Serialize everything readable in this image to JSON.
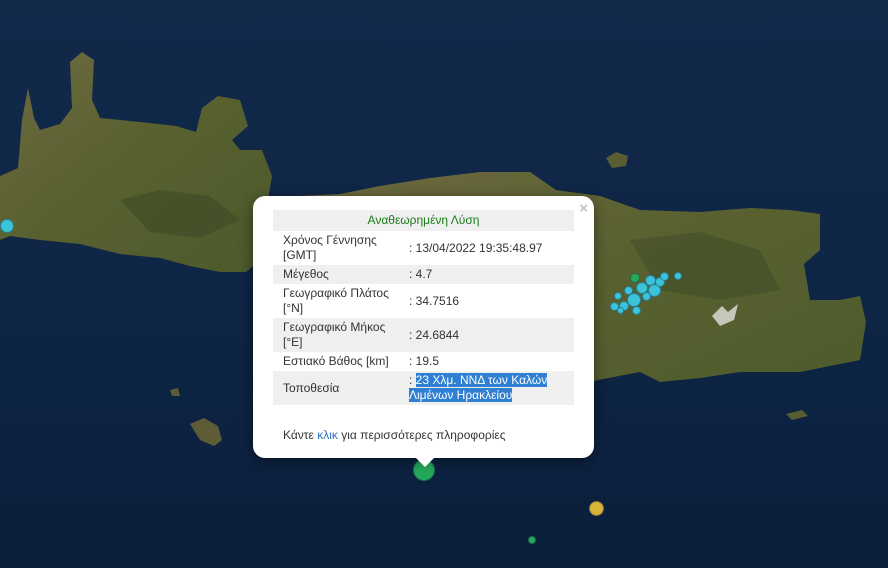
{
  "popup": {
    "close_symbol": "×",
    "heading": "Αναθεωρημένη Λύση",
    "rows": [
      {
        "label": "Χρόνος Γέννησης [GMT]",
        "value": ": 13/04/2022 19:35:48.97"
      },
      {
        "label": "Μέγεθος",
        "value": ": 4.7"
      },
      {
        "label": "Γεωγραφικό Πλάτος [°N]",
        "value": ": 34.7516"
      },
      {
        "label": "Γεωγραφικό Μήκος [°E]",
        "value": ": 24.6844"
      },
      {
        "label": "Εστιακό Βάθος [km]",
        "value": ": 19.5"
      },
      {
        "label": "Τοποθεσία",
        "value_prefix": ": ",
        "value": "23 Χλμ. ΝΝΔ των Καλών Λιμένων Ηρακλείου"
      }
    ],
    "more_prefix": "Κάντε ",
    "more_link": "κλικ",
    "more_suffix": " για περισσότερες πληροφορίες"
  },
  "map": {
    "sea_color": "#0f2747",
    "land_color": "#5f6238",
    "marker_colors": {
      "cyan": "#3bc4d9",
      "green": "#25a85a",
      "yellow": "#d8b43a"
    }
  }
}
